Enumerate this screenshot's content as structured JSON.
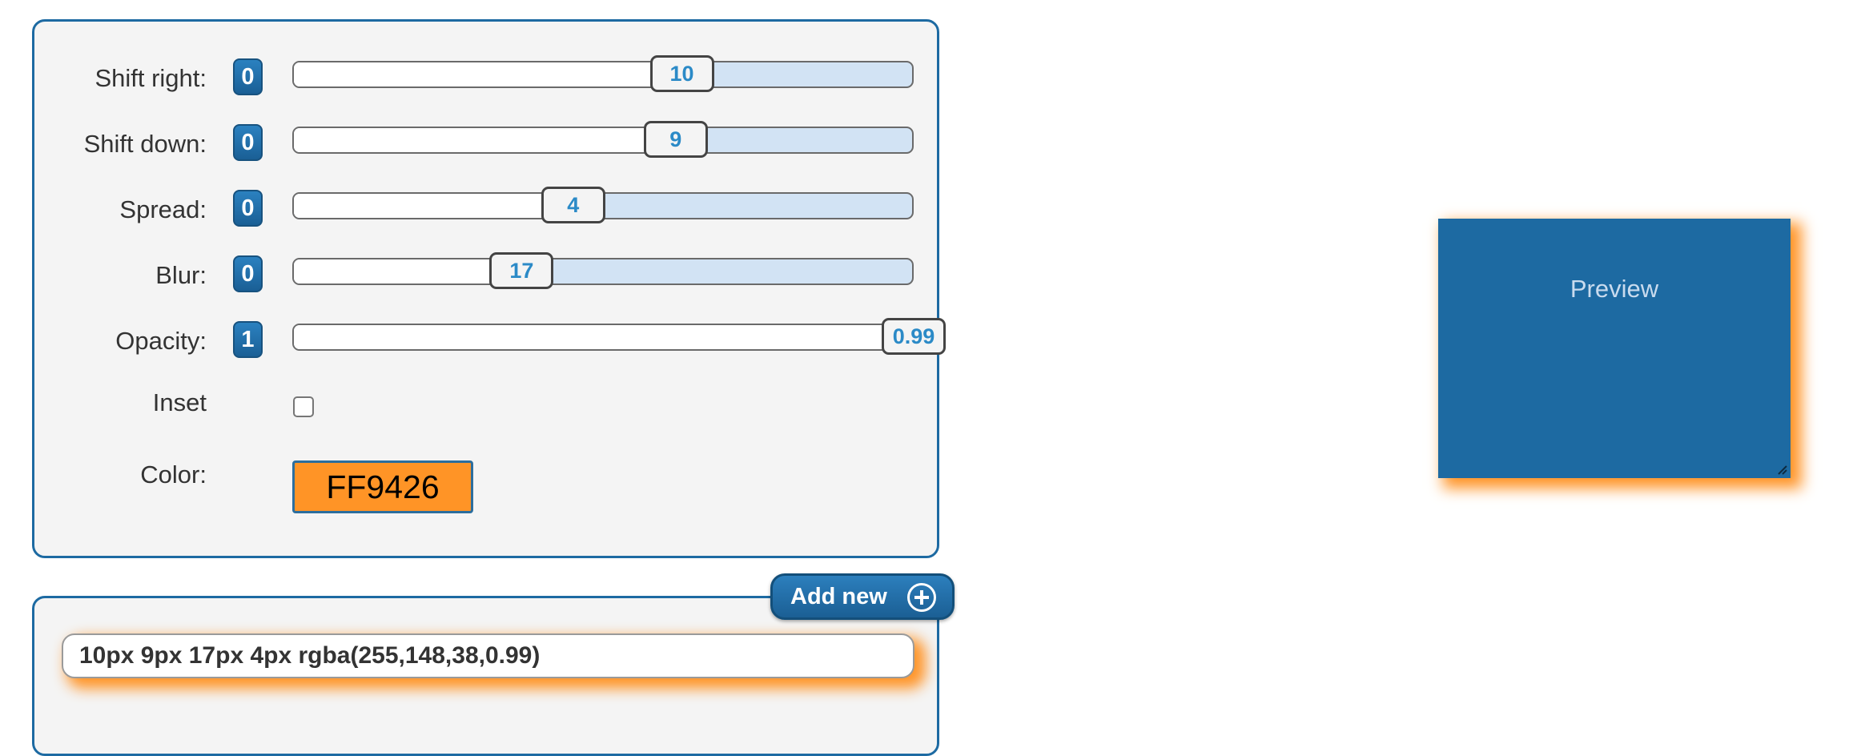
{
  "sliders": [
    {
      "label": "Shift right:",
      "badge": "0",
      "value": "10",
      "fraction": 0.627
    },
    {
      "label": "Shift down:",
      "badge": "0",
      "value": "9",
      "fraction": 0.617
    },
    {
      "label": "Spread:",
      "badge": "0",
      "value": "4",
      "fraction": 0.452
    },
    {
      "label": "Blur:",
      "badge": "0",
      "value": "17",
      "fraction": 0.369
    },
    {
      "label": "Opacity:",
      "badge": "1",
      "value": "0.99",
      "fraction": 1.0
    }
  ],
  "inset": {
    "label": "Inset",
    "checked": false
  },
  "color": {
    "label": "Color:",
    "value": "FF9426",
    "swatch": "#ff9426"
  },
  "add_new": {
    "label": "Add new",
    "icon": "plus-circle-icon"
  },
  "shadow_value": "10px 9px 17px 4px rgba(255,148,38,0.99)",
  "preview": {
    "label": "Preview"
  },
  "colors": {
    "accent": "#1d6aa2",
    "track_fill": "#d2e3f4",
    "thumb_text": "#2b8ac7",
    "shadow": "#ff9426"
  }
}
